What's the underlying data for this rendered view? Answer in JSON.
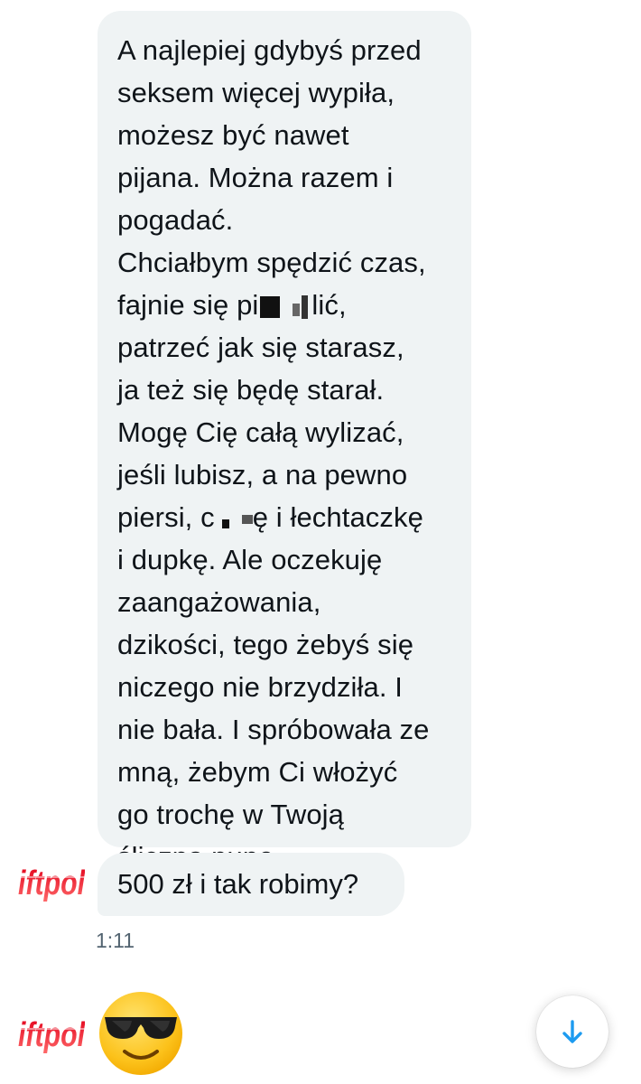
{
  "conversation": {
    "message_1_lines": [
      "A najlepiej gdybyś przed",
      "seksem więcej wypiła,",
      "możesz być nawet",
      "pijana. Można razem i",
      "pogadać.",
      "Chciałbym spędzić czas,",
      "fajnie się pi",
      "lić,",
      "patrzeć jak się starasz,",
      "ja też się będę starał.",
      "Mogę Cię całą wylizać,",
      "jeśli lubisz, a na pewno",
      "piersi, c",
      "ę i łechtaczkę",
      "i dupkę. Ale oczekuję",
      "zaangażowania,",
      "dzikości, tego żebyś się",
      "niczego nie brzydziła. I",
      "nie bała. I spróbowała ze",
      "mną, żebym Ci włożyć",
      "go trochę w Twoją",
      "śliczną pupę."
    ],
    "message_2": "500 zł i tak robimy?",
    "timestamp": "1:11",
    "reaction_emoji": "😎"
  },
  "watermark": {
    "text": "iftpol"
  },
  "icons": {
    "emoji": "smiling-face-with-sunglasses-icon",
    "scroll": "arrow-down-icon",
    "avatar": "avatar-icon"
  },
  "colors": {
    "bubble_background": "#eff3f4",
    "text": "#0f1419",
    "timestamp": "#536471",
    "accent": "#1d9bf0",
    "watermark_red": "#e2001a"
  }
}
